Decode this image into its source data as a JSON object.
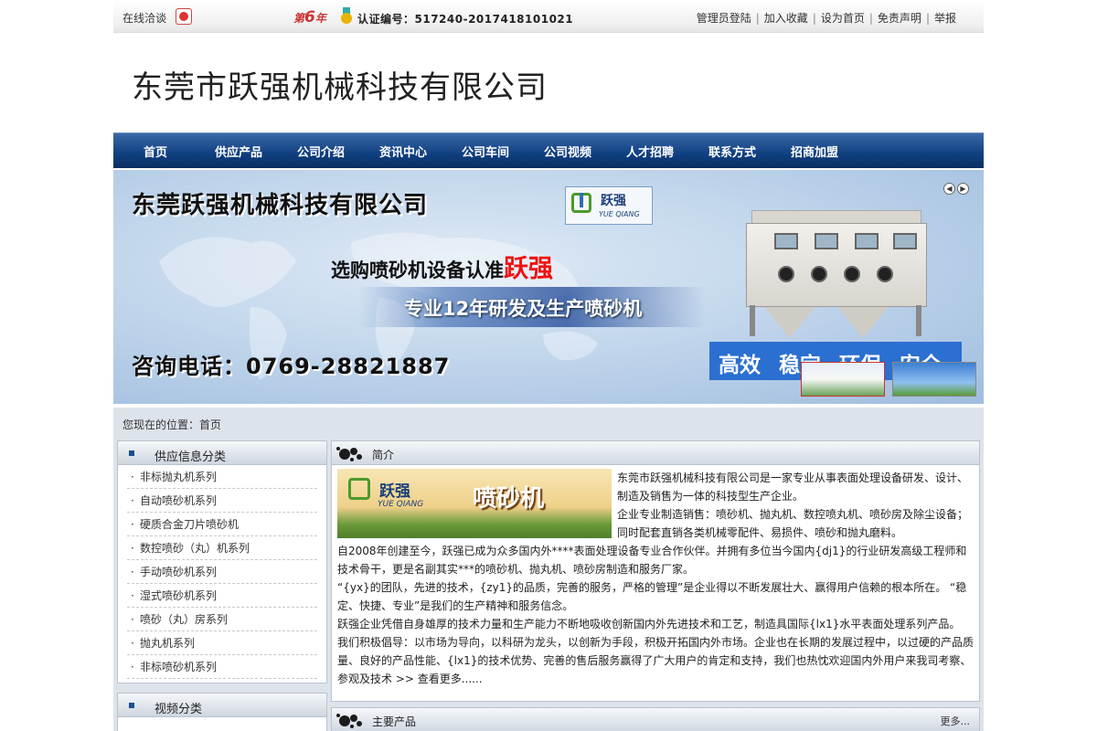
{
  "topbar": {
    "chat_label": "在线洽谈",
    "years_prefix": "第",
    "years_num": "6",
    "years_suffix": "年",
    "cert": "认证编号：517240-2017418101021",
    "links": [
      "管理员登陆",
      "加入收藏",
      "设为首页",
      "免责声明",
      "举报"
    ]
  },
  "company_name": "东莞市跃强机械科技有限公司",
  "nav": [
    "首页",
    "供应产品",
    "公司介绍",
    "资讯中心",
    "公司车间",
    "公司视频",
    "人才招聘",
    "联系方式",
    "招商加盟"
  ],
  "banner": {
    "title": "东莞跃强机械科技有限公司",
    "logo_cn": "跃强",
    "logo_en": "YUE QIANG",
    "slogan": "选购喷砂机设备认准",
    "slogan_brand": "跃强",
    "pro": "专业12年研发及生产喷砂机",
    "phone": "咨询电话：0769-28821887",
    "badge_words": [
      "高效",
      "稳定",
      "环保",
      "安全"
    ]
  },
  "breadcrumb": "您现在的位置：首页",
  "sidebar": {
    "supply_title": "供应信息分类",
    "supply_items": [
      "非标抛丸机系列",
      "自动喷砂机系列",
      "硬质合金刀片喷砂机",
      "数控喷砂（丸）机系列",
      "手动喷砂机系列",
      "湿式喷砂机系列",
      "喷砂（丸）房系列",
      "抛丸机系列",
      "非标喷砂机系列"
    ],
    "video_title": "视频分类"
  },
  "intro": {
    "title": "简介",
    "img_cn": "跃强",
    "img_en": "YUE QIANG",
    "img_product": "喷砂机",
    "paragraphs": [
      "东莞市跃强机械科技有限公司是一家专业从事表面处理设备研发、设计、制造及销售为一体的科技型生产企业。",
      "企业专业制造销售：喷砂机、抛丸机、数控喷丸机、喷砂房及除尘设备；同时配套直销各类机械零配件、易损件、喷砂和抛丸磨料。",
      "自2008年创建至今，跃强已成为众多国内外****表面处理设备专业合作伙伴。并拥有多位当今国内{dj1}的行业研发高级工程师和技术骨干，更是名副其实***的喷砂机、抛丸机、喷砂房制造和服务厂家。",
      "“{yx}的团队，先进的技术，{zy1}的品质，完善的服务，严格的管理”是企业得以不断发展壮大、赢得用户信赖的根本所在。 “稳定、快捷、专业”是我们的生产精神和服务信念。",
      "跃强企业凭借自身雄厚的技术力量和生产能力不断地吸收创新国内外先进技术和工艺，制造具国际{lx1}水平表面处理系列产品。",
      "我们积极倡导：以市场为导向，以科研为龙头，以创新为手段，积极开拓国内外市场。企业也在长期的发展过程中，以过硬的产品质量、良好的产品性能、{lx1}的技术优势、完善的售后服务赢得了广大用户的肯定和支持，我们也热忱欢迎国内外用户来我司考察、参观及技术 >> 查看更多......"
    ]
  },
  "products": {
    "title": "主要产品",
    "more": "更多..."
  }
}
